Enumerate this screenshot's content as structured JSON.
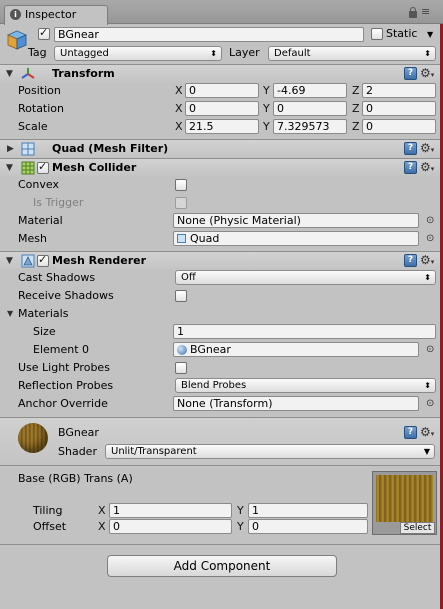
{
  "tab": {
    "title": "Inspector",
    "icon": "info-icon"
  },
  "object": {
    "name": "BGnear",
    "active": true,
    "static_label": "Static",
    "static_checked": false,
    "tag_label": "Tag",
    "tag_value": "Untagged",
    "layer_label": "Layer",
    "layer_value": "Default"
  },
  "transform": {
    "title": "Transform",
    "position_label": "Position",
    "rotation_label": "Rotation",
    "scale_label": "Scale",
    "position": {
      "x": "0",
      "y": "-4.69",
      "z": "2"
    },
    "rotation": {
      "x": "0",
      "y": "0",
      "z": "0"
    },
    "scale": {
      "x": "21.5",
      "y": "7.329573",
      "z": "0"
    },
    "axis": {
      "x": "X",
      "y": "Y",
      "z": "Z"
    }
  },
  "mesh_filter": {
    "title": "Quad (Mesh Filter)"
  },
  "mesh_collider": {
    "title": "Mesh Collider",
    "enabled": true,
    "convex_label": "Convex",
    "convex_checked": false,
    "is_trigger_label": "Is Trigger",
    "is_trigger_checked": false,
    "material_label": "Material",
    "material_value": "None (Physic Material)",
    "mesh_label": "Mesh",
    "mesh_value": "Quad"
  },
  "mesh_renderer": {
    "title": "Mesh Renderer",
    "enabled": true,
    "cast_shadows_label": "Cast Shadows",
    "cast_shadows_value": "Off",
    "receive_shadows_label": "Receive Shadows",
    "receive_shadows_checked": false,
    "materials_label": "Materials",
    "size_label": "Size",
    "size_value": "1",
    "element0_label": "Element 0",
    "element0_value": "BGnear",
    "light_probes_label": "Use Light Probes",
    "light_probes_checked": false,
    "reflection_probes_label": "Reflection Probes",
    "reflection_probes_value": "Blend Probes",
    "anchor_override_label": "Anchor Override",
    "anchor_override_value": "None (Transform)"
  },
  "material": {
    "name": "BGnear",
    "shader_label": "Shader",
    "shader_value": "Unlit/Transparent",
    "texture_prop_label": "Base (RGB) Trans (A)",
    "tiling_label": "Tiling",
    "offset_label": "Offset",
    "tiling": {
      "x": "1",
      "y": "1"
    },
    "offset": {
      "x": "0",
      "y": "0"
    },
    "select_label": "Select"
  },
  "add_component_label": "Add Component",
  "colors": {
    "panel_bg": "#c2c2c2",
    "header_bg": "#c8c8c8",
    "accent_blue": "#3d6fa8"
  }
}
